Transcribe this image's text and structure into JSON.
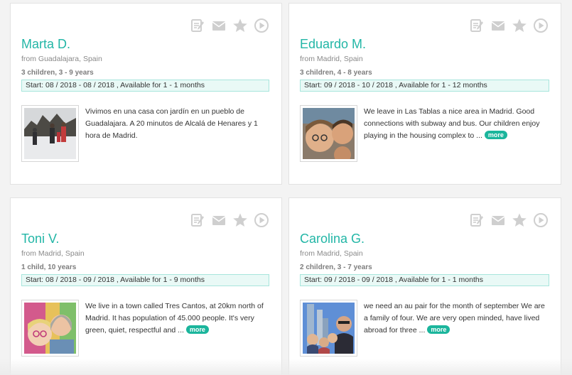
{
  "icon_color": "#cfcfcf",
  "accent_color": "#22b6a6",
  "more_label": "more",
  "profiles": [
    {
      "name": "Marta D.",
      "from": "from Guadalajara, Spain",
      "children": "3 children, 3 - 9 years",
      "availability": "Start: 08 / 2018 - 08 / 2018 , Available for 1 - 1 months",
      "description": "Vivimos en una casa con jardín en un pueblo de Guadalajara. A 20 minutos de Alcalá de Henares y 1 hora de Madrid.",
      "has_more": false
    },
    {
      "name": "Eduardo M.",
      "from": "from Madrid, Spain",
      "children": "3 children, 4 - 8 years",
      "availability": "Start: 09 / 2018 - 10 / 2018 , Available for 1 - 12 months",
      "description": "We leave in Las Tablas a nice area in Madrid. Good connections with subway and bus. Our children enjoy playing in the housing complex to ...",
      "has_more": true
    },
    {
      "name": "Toni V.",
      "from": "from Madrid, Spain",
      "children": "1 child, 10 years",
      "availability": "Start: 08 / 2018 - 09 / 2018 , Available for 1 - 9 months",
      "description": "We live in a town called Tres Cantos, at 20km north of Madrid. It has population of 45.000 people. It's very green, quiet, respectful and ...",
      "has_more": true
    },
    {
      "name": "Carolina G.",
      "from": "from Madrid, Spain",
      "children": "2 children, 3 - 7 years",
      "availability": "Start: 09 / 2018 - 09 / 2018 , Available for 1 - 1 months",
      "description": "we need an au pair for the month of september We are a family of four. We are very open minded, have lived abroad for three ...",
      "has_more": true
    }
  ]
}
